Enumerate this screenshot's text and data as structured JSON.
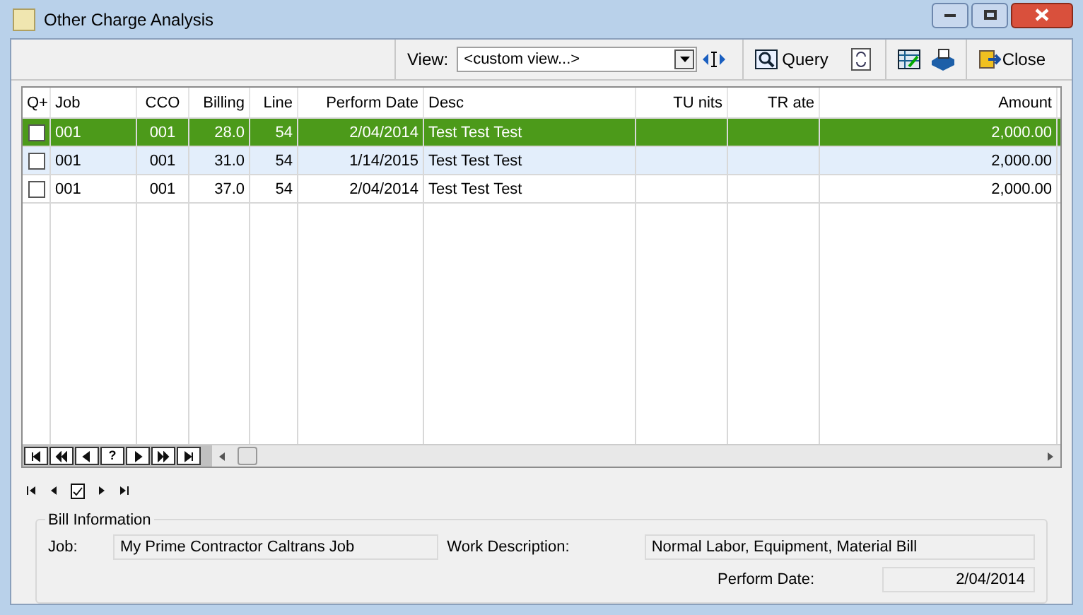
{
  "window": {
    "title": "Other Charge Analysis"
  },
  "toolbar": {
    "view_label": "View:",
    "view_value": "<custom view...>",
    "query": "Query",
    "close": "Close"
  },
  "table": {
    "columns": [
      "Q+",
      "Job",
      "CCO",
      "Billing",
      "Line",
      "Perform Date",
      "Desc",
      "TU nits",
      "TR ate",
      "Amount"
    ],
    "rows": [
      {
        "selected": true,
        "checked": false,
        "cells": [
          "",
          "001",
          "001",
          "28.0",
          "54",
          "2/04/2014",
          "Test Test Test",
          "",
          "",
          "2,000.00"
        ]
      },
      {
        "selected": false,
        "checked": false,
        "cells": [
          "",
          "001",
          "001",
          "31.0",
          "54",
          "1/14/2015",
          "Test Test Test",
          "",
          "",
          "2,000.00"
        ]
      },
      {
        "selected": false,
        "checked": false,
        "cells": [
          "",
          "001",
          "001",
          "37.0",
          "54",
          "2/04/2014",
          "Test Test Test",
          "",
          "",
          "2,000.00"
        ]
      }
    ],
    "nav_help": "?"
  },
  "bill_information": {
    "title": "Bill Information",
    "job_label": "Job:",
    "job": "My Prime Contractor Caltrans Job",
    "work_description_label": "Work Description:",
    "work_description": "Normal Labor, Equipment, Material Bill",
    "perform_date_label": "Perform Date:",
    "perform_date": "2/04/2014"
  }
}
